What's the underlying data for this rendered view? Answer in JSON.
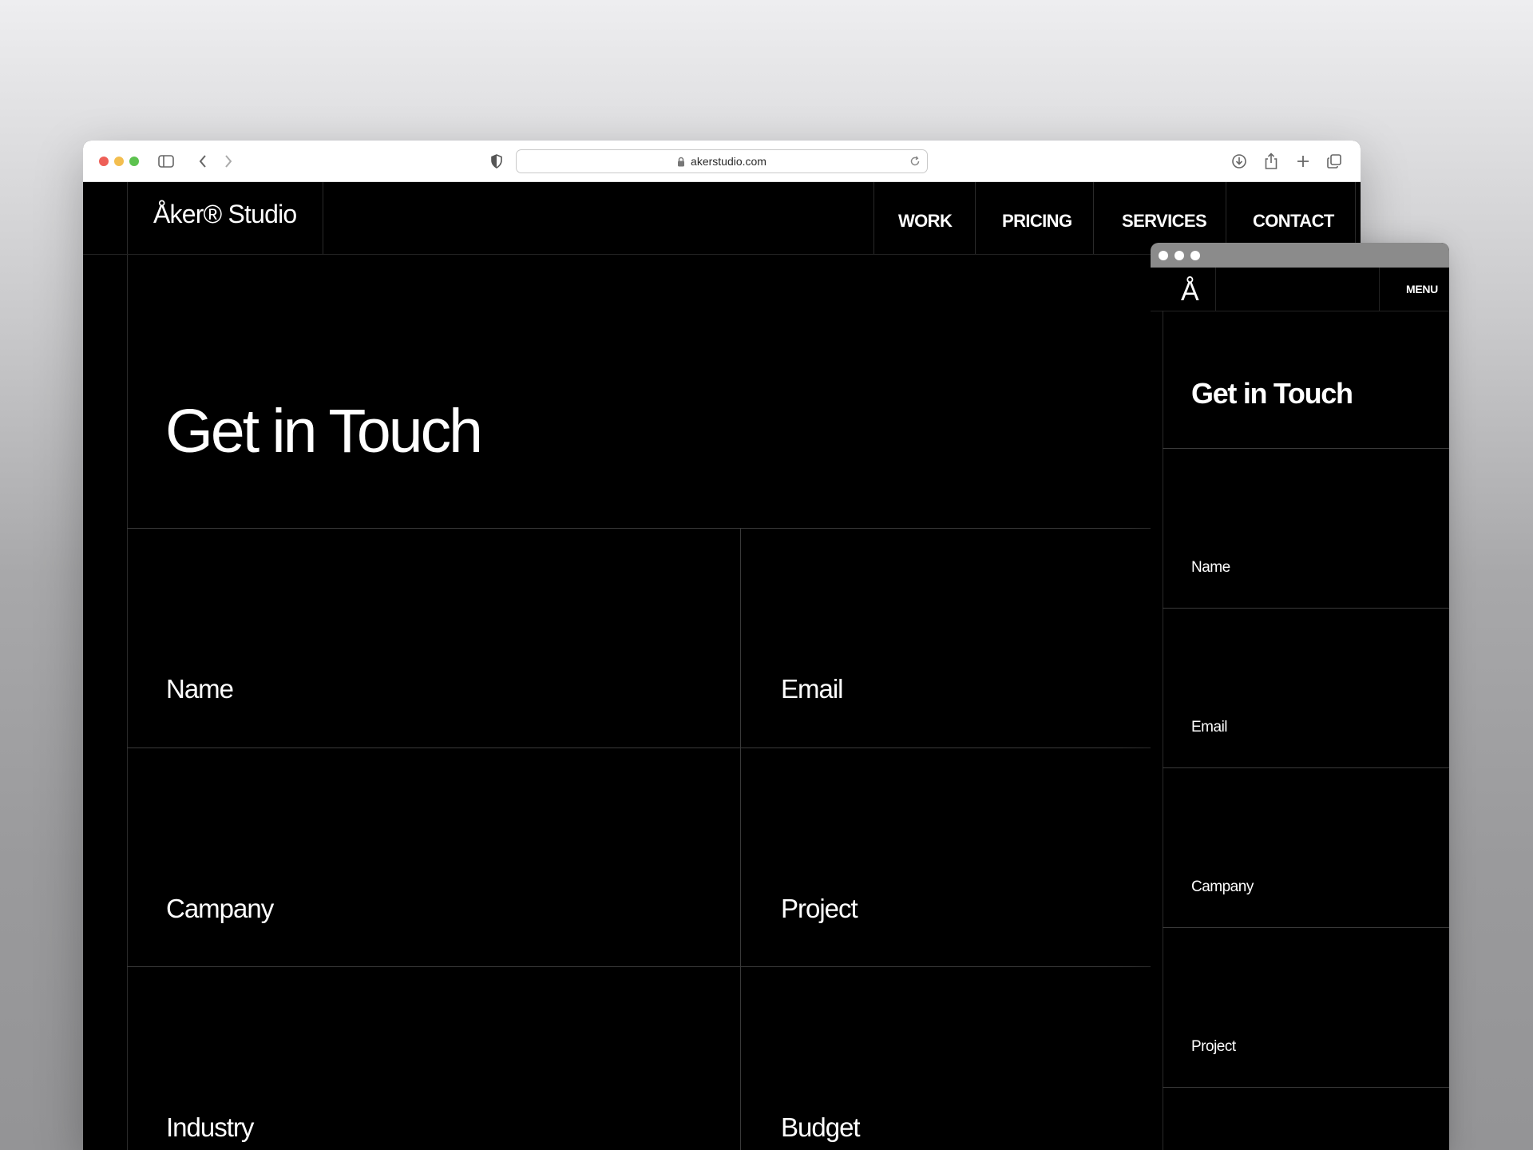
{
  "browser": {
    "url": "akerstudio.com",
    "icons": [
      "sidebar-icon",
      "back-icon",
      "forward-icon",
      "shield-icon",
      "lock-icon",
      "reload-icon",
      "download-icon",
      "share-icon",
      "new-tab-icon",
      "tabs-overview-icon"
    ]
  },
  "desktop": {
    "logo": "Åker® Studio",
    "nav": {
      "work": "WORK",
      "pricing": "PRICING",
      "services": "SERVICES",
      "contact": "CONTACT"
    },
    "title": "Get in Touch",
    "fields": {
      "name": "Name",
      "email": "Email",
      "company": "Campany",
      "project": "Project",
      "industry": "Industry",
      "budget": "Budget"
    }
  },
  "mobile": {
    "logo": "Å",
    "menu": "MENU",
    "title": "Get in Touch",
    "fields": {
      "name": "Name",
      "email": "Email",
      "company": "Campany",
      "project": "Project"
    }
  },
  "colors": {
    "background": "#000000",
    "text": "#ffffff",
    "grid_lines": "#3a3a3a"
  }
}
